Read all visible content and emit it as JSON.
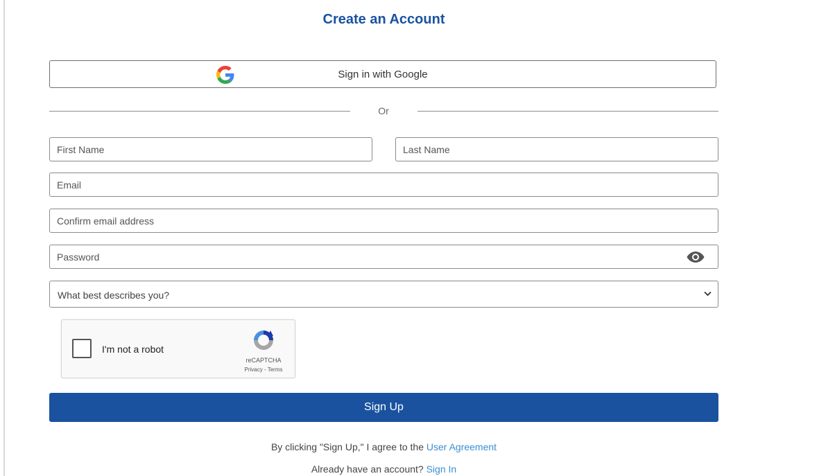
{
  "title": "Create an Account",
  "google": {
    "label": "Sign in with Google",
    "icon": "google-icon"
  },
  "divider": {
    "label": "Or"
  },
  "form": {
    "first_name": {
      "placeholder": "First Name",
      "value": ""
    },
    "last_name": {
      "placeholder": "Last Name",
      "value": ""
    },
    "email": {
      "placeholder": "Email",
      "value": ""
    },
    "confirm_email": {
      "placeholder": "Confirm email address",
      "value": ""
    },
    "password": {
      "placeholder": "Password",
      "value": "",
      "toggle_icon": "eye-icon"
    },
    "role_select": {
      "selected": "What best describes you?",
      "icon": "chevron-down-icon"
    }
  },
  "captcha": {
    "label": "I'm not a robot",
    "brand": "reCAPTCHA",
    "privacy": "Privacy",
    "separator": " - ",
    "terms": "Terms",
    "icon": "recaptcha-icon"
  },
  "signup": {
    "label": "Sign Up"
  },
  "agreement": {
    "prefix": "By clicking \"Sign Up,\" I agree to the ",
    "link": "User Agreement"
  },
  "signin": {
    "prefix": "Already have an account? ",
    "link": "Sign In"
  },
  "colors": {
    "primary": "#1a52a0",
    "link": "#3b8ed0"
  }
}
